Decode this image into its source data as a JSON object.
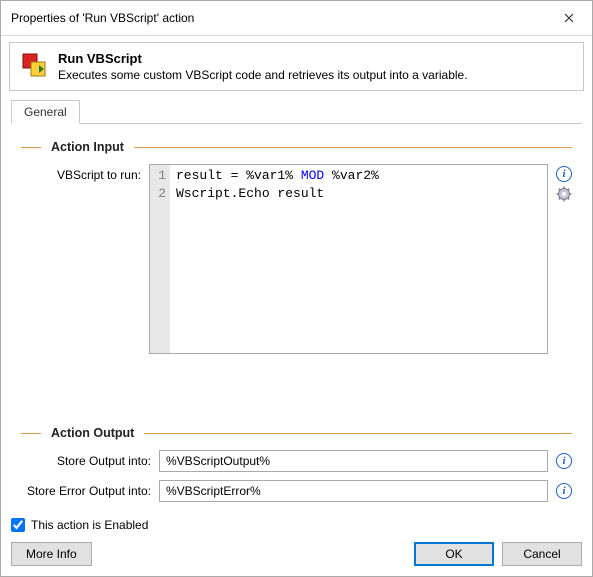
{
  "window": {
    "title": "Properties of 'Run VBScript' action"
  },
  "header": {
    "title": "Run VBScript",
    "description": "Executes some custom VBScript code and retrieves its output into a variable."
  },
  "tabs": [
    {
      "label": "General"
    }
  ],
  "sections": {
    "input": {
      "heading": "Action Input",
      "vbscript_label": "VBScript to run:",
      "code_lines": [
        {
          "n": "1",
          "plain1": "result = %var1% ",
          "kw": "MOD",
          "plain2": " %var2%"
        },
        {
          "n": "2",
          "plain1": "Wscript.Echo result",
          "kw": "",
          "plain2": ""
        }
      ]
    },
    "output": {
      "heading": "Action Output",
      "store_output_label": "Store Output into:",
      "store_output_value": "%VBScriptOutput%",
      "store_error_label": "Store Error Output into:",
      "store_error_value": "%VBScriptError%"
    }
  },
  "footer": {
    "enabled_label": "This action is Enabled",
    "enabled_checked": true,
    "more_info": "More Info",
    "ok": "OK",
    "cancel": "Cancel"
  }
}
